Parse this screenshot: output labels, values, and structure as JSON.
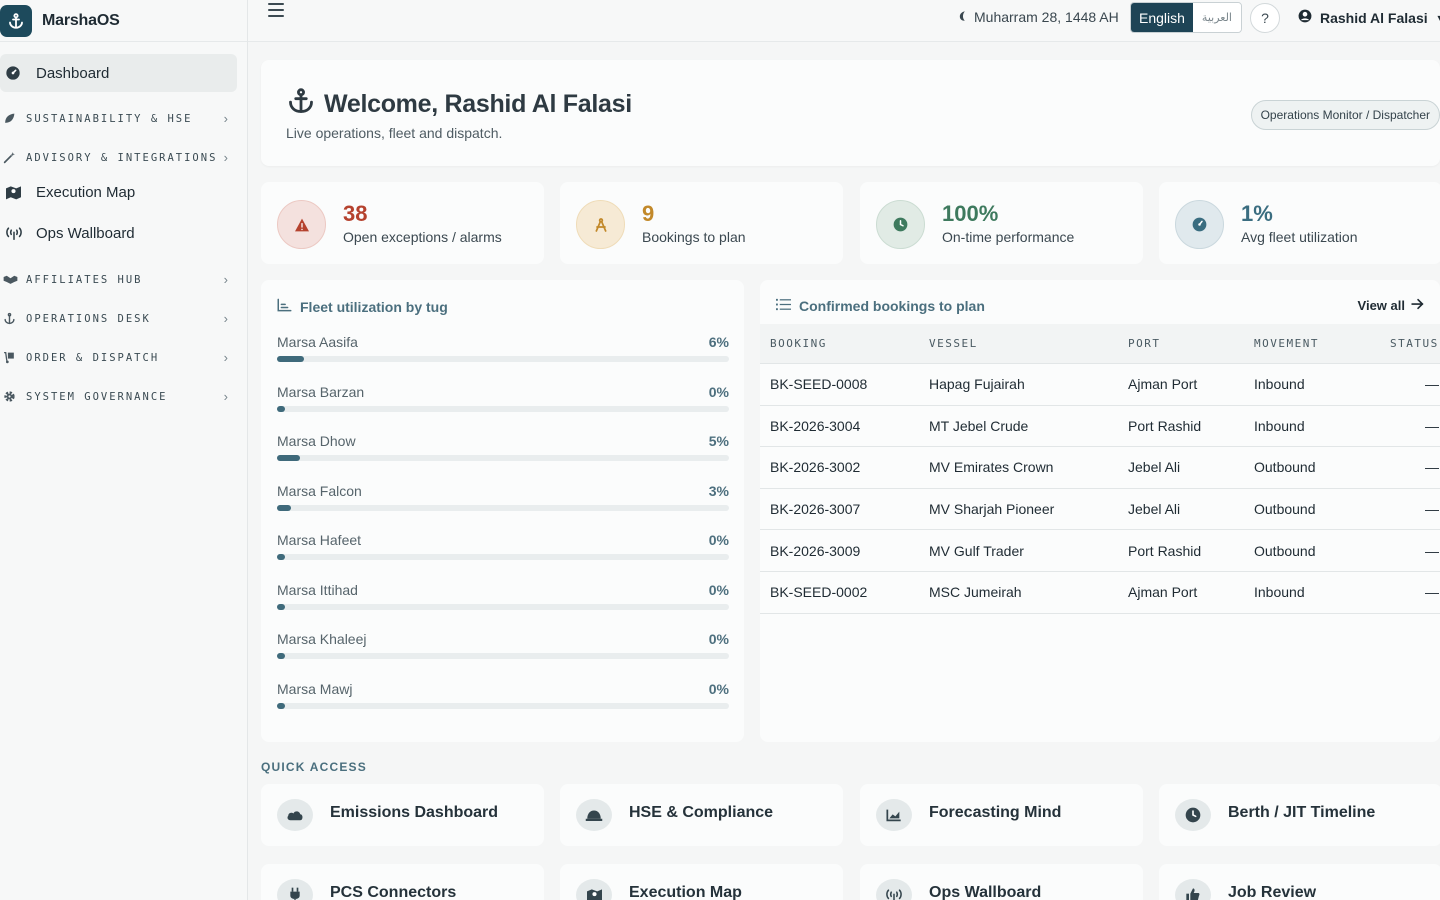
{
  "app": {
    "name": "MarshaOS"
  },
  "topbar": {
    "date": "Muharram 28, 1448 AH",
    "lang_en": "English",
    "lang_ar": "العربية",
    "help": "?",
    "user": "Rashid Al Falasi"
  },
  "sidebar": {
    "dashboard": "Dashboard",
    "sustainability": "SUSTAINABILITY & HSE",
    "advisory": "ADVISORY & INTEGRATIONS",
    "execution_map": "Execution Map",
    "ops_wallboard": "Ops Wallboard",
    "affiliates": "AFFILIATES HUB",
    "operations": "OPERATIONS DESK",
    "order": "ORDER & DISPATCH",
    "governance": "SYSTEM GOVERNANCE"
  },
  "welcome": {
    "title": "Welcome, Rashid Al Falasi",
    "subtitle": "Live operations, fleet and dispatch.",
    "role": "Operations Monitor / Dispatcher"
  },
  "kpis": [
    {
      "value": "38",
      "label": "Open exceptions / alarms",
      "color": "#b5422e",
      "icon": "warning-icon"
    },
    {
      "value": "9",
      "label": "Bookings to plan",
      "color": "#c2892a",
      "icon": "compass-icon"
    },
    {
      "value": "100%",
      "label": "On-time performance",
      "color": "#3e7a5e",
      "icon": "clock-icon"
    },
    {
      "value": "1%",
      "label": "Avg fleet utilization",
      "color": "#3a6d80",
      "icon": "gauge-icon"
    }
  ],
  "fleet": {
    "title": "Fleet utilization by tug",
    "tugs": [
      {
        "name": "Marsa Aasifa",
        "pct_label": "6%",
        "pct": 6
      },
      {
        "name": "Marsa Barzan",
        "pct_label": "0%",
        "pct": 0
      },
      {
        "name": "Marsa Dhow",
        "pct_label": "5%",
        "pct": 5
      },
      {
        "name": "Marsa Falcon",
        "pct_label": "3%",
        "pct": 3
      },
      {
        "name": "Marsa Hafeet",
        "pct_label": "0%",
        "pct": 0
      },
      {
        "name": "Marsa Ittihad",
        "pct_label": "0%",
        "pct": 0
      },
      {
        "name": "Marsa Khaleej",
        "pct_label": "0%",
        "pct": 0
      },
      {
        "name": "Marsa Mawj",
        "pct_label": "0%",
        "pct": 0
      }
    ]
  },
  "bookings": {
    "title": "Confirmed bookings to plan",
    "view_all": "View all",
    "columns": [
      "BOOKING",
      "VESSEL",
      "PORT",
      "MOVEMENT",
      "STATUS"
    ],
    "rows": [
      [
        "BK-SEED-0008",
        "Hapag Fujairah",
        "Ajman Port",
        "Inbound",
        "—"
      ],
      [
        "BK-2026-3004",
        "MT Jebel Crude",
        "Port Rashid",
        "Inbound",
        "—"
      ],
      [
        "BK-2026-3002",
        "MV Emirates Crown",
        "Jebel Ali",
        "Outbound",
        "—"
      ],
      [
        "BK-2026-3007",
        "MV Sharjah Pioneer",
        "Jebel Ali",
        "Outbound",
        "—"
      ],
      [
        "BK-2026-3009",
        "MV Gulf Trader",
        "Port Rashid",
        "Outbound",
        "—"
      ],
      [
        "BK-SEED-0002",
        "MSC Jumeirah",
        "Ajman Port",
        "Inbound",
        "—"
      ]
    ]
  },
  "quick_access": {
    "label": "QUICK ACCESS",
    "items": [
      {
        "label": "Emissions Dashboard",
        "icon": "cloud-icon"
      },
      {
        "label": "HSE & Compliance",
        "icon": "hard-hat-icon"
      },
      {
        "label": "Forecasting Mind",
        "icon": "chart-icon"
      },
      {
        "label": "Berth / JIT Timeline",
        "icon": "clock-icon"
      },
      {
        "label": "PCS Connectors",
        "icon": "plug-icon"
      },
      {
        "label": "Execution Map",
        "icon": "map-icon"
      },
      {
        "label": "Ops Wallboard",
        "icon": "broadcast-icon"
      },
      {
        "label": "Job Review",
        "icon": "thumbs-up-icon"
      }
    ]
  }
}
